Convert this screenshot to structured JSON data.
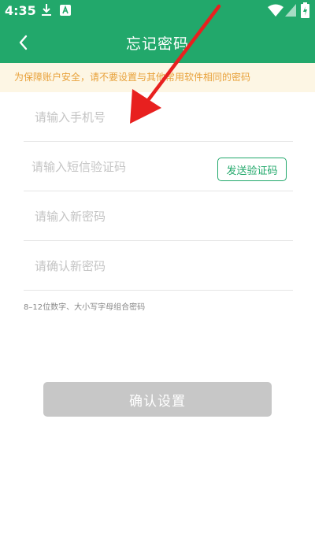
{
  "status_bar": {
    "time": "4:35",
    "icons": [
      "download-icon",
      "app-notification-icon",
      "wifi-icon",
      "signal-icon",
      "battery-icon"
    ]
  },
  "header": {
    "title": "忘记密码",
    "back_icon": "chevron-left-icon"
  },
  "notice": {
    "text": "为保障账户安全，请不要设置与其他常用软件相同的密码"
  },
  "form": {
    "phone_placeholder": "请输入手机号",
    "sms_placeholder": "请输入短信验证码",
    "send_code_label": "发送验证码",
    "new_password_placeholder": "请输入新密码",
    "confirm_password_placeholder": "请确认新密码",
    "hint": "8–12位数字、大小写字母组合密码",
    "confirm_label": "确认设置"
  },
  "colors": {
    "brand": "#22a86b",
    "notice_bg": "#fdf6e4",
    "notice_text": "#e8a13a",
    "disabled_button": "#c7c7c7",
    "annotation_arrow": "#e8201f"
  }
}
